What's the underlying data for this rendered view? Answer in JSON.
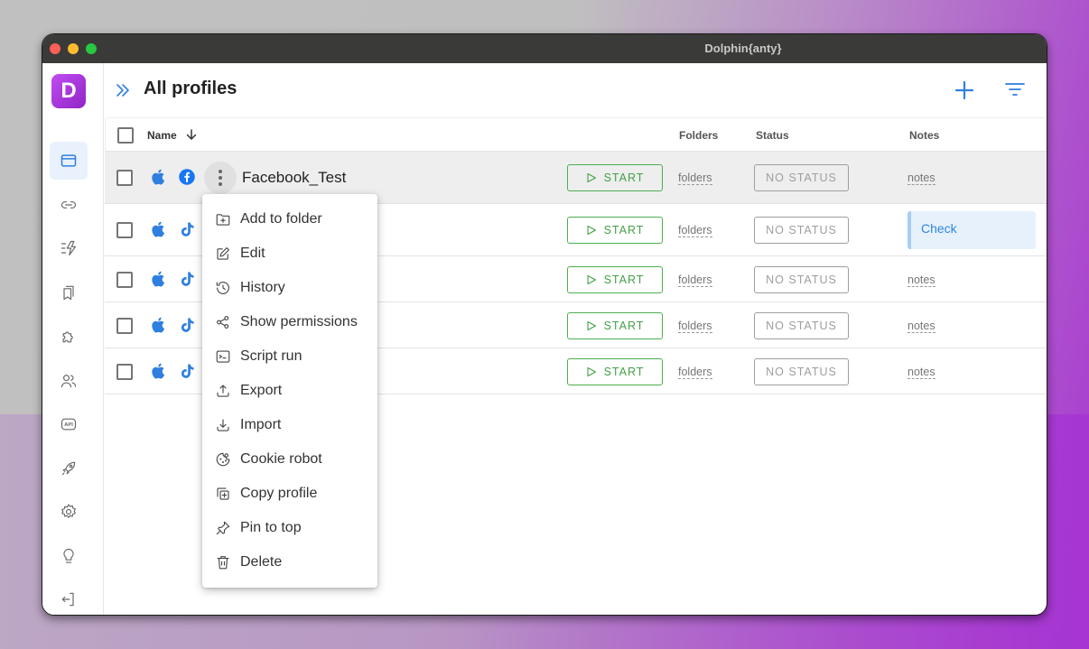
{
  "window": {
    "title": "Dolphin{anty}",
    "logo_letter": "D"
  },
  "colors": {
    "accent": "#2f7fe0",
    "start_green": "#43a047",
    "status_grey": "#9e9e9e",
    "logo_purple": "#a535de"
  },
  "sidebar": {
    "items": [
      {
        "name": "profiles",
        "icon": "browser-window-icon",
        "active": true
      },
      {
        "name": "proxies",
        "icon": "link-icon",
        "active": false
      },
      {
        "name": "automation",
        "icon": "flash-icon",
        "active": false
      },
      {
        "name": "bookmarks",
        "icon": "bookmarks-icon",
        "active": false
      },
      {
        "name": "extensions",
        "icon": "puzzle-icon",
        "active": false
      },
      {
        "name": "team",
        "icon": "users-icon",
        "active": false
      },
      {
        "name": "api",
        "icon": "api-icon",
        "active": false,
        "label": "API"
      },
      {
        "name": "launch",
        "icon": "rocket-icon",
        "active": false
      },
      {
        "name": "settings",
        "icon": "gear-icon",
        "active": false
      },
      {
        "name": "tips",
        "icon": "lightbulb-icon",
        "active": false
      },
      {
        "name": "logout",
        "icon": "logout-icon",
        "active": false
      }
    ]
  },
  "header": {
    "title": "All profiles",
    "add_icon": "plus-icon",
    "filter_icon": "filter-icon"
  },
  "table": {
    "columns": {
      "name": "Name",
      "folders": "Folders",
      "status": "Status",
      "notes": "Notes"
    },
    "sort": "descending",
    "rows": [
      {
        "name": "Facebook_Test",
        "os": "apple",
        "platform": "facebook",
        "start": "START",
        "folders": "folders",
        "status": "NO STATUS",
        "notes": "notes",
        "highlighted": true
      },
      {
        "name": "",
        "os": "apple",
        "platform": "tiktok",
        "start": "START",
        "folders": "folders",
        "status": "NO STATUS",
        "notes": "Check",
        "note_is_box": true
      },
      {
        "name": "",
        "os": "apple",
        "platform": "tiktok",
        "start": "START",
        "folders": "folders",
        "status": "NO STATUS",
        "notes": "notes"
      },
      {
        "name": "",
        "os": "apple",
        "platform": "tiktok",
        "start": "START",
        "folders": "folders",
        "status": "NO STATUS",
        "notes": "notes"
      },
      {
        "name": "",
        "os": "apple",
        "platform": "tiktok",
        "start": "START",
        "folders": "folders",
        "status": "NO STATUS",
        "notes": "notes"
      }
    ]
  },
  "context_menu": {
    "items": [
      {
        "label": "Add to folder",
        "icon": "folder-plus-icon"
      },
      {
        "label": "Edit",
        "icon": "edit-icon"
      },
      {
        "label": "History",
        "icon": "history-icon"
      },
      {
        "label": "Show permissions",
        "icon": "share-icon"
      },
      {
        "label": "Script run",
        "icon": "terminal-icon"
      },
      {
        "label": "Export",
        "icon": "upload-icon"
      },
      {
        "label": "Import",
        "icon": "download-icon"
      },
      {
        "label": "Cookie robot",
        "icon": "cookie-icon"
      },
      {
        "label": "Copy profile",
        "icon": "copy-icon"
      },
      {
        "label": "Pin to top",
        "icon": "pin-icon"
      },
      {
        "label": "Delete",
        "icon": "trash-icon"
      }
    ]
  }
}
